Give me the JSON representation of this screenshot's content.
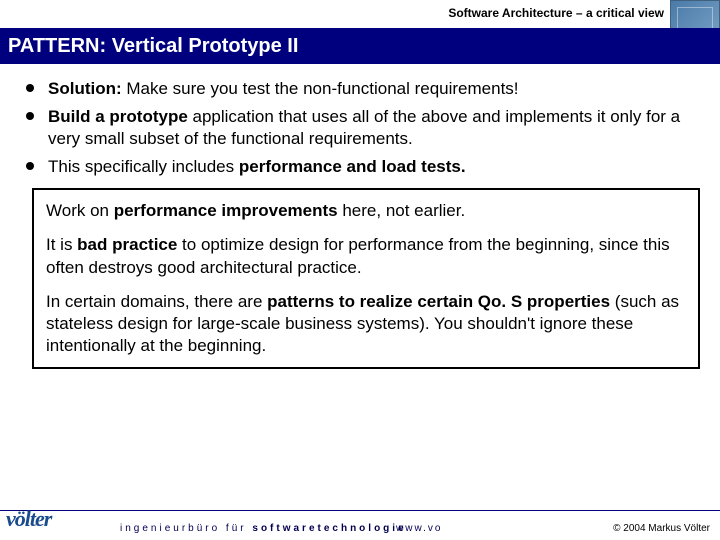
{
  "header": {
    "subtitle": "Software Architecture – a critical view",
    "title": "PATTERN: Vertical Prototype II"
  },
  "bullets": {
    "b1_lead": "Solution:",
    "b1_rest": " Make sure you test the non-functional requirements!",
    "b2_lead": "Build a prototype",
    "b2_rest": " application that uses all of the above and implements it only for a very small subset of the functional requirements.",
    "b3_pre": "This specifically includes ",
    "b3_bold": "performance and load tests."
  },
  "box": {
    "p1_pre": "Work on ",
    "p1_bold": "performance improvements",
    "p1_post": " here, not earlier.",
    "p2_pre": "It is ",
    "p2_bold": "bad practice",
    "p2_post": " to optimize design for performance from the beginning, since this often destroys good architectural practice.",
    "p3_pre": "In certain domains, there are ",
    "p3_bold": "patterns to realize certain Qo. S properties",
    "p3_post": " (such as stateless design for large-scale business systems). You shouldn't ignore these intentionally at the beginning."
  },
  "footer": {
    "logo": "völter",
    "tag_part1": "ingenieurbüro für ",
    "tag_part2": "softwaretechnologie",
    "url": "www.vo",
    "copyright": "© 2004  Markus Völter"
  }
}
